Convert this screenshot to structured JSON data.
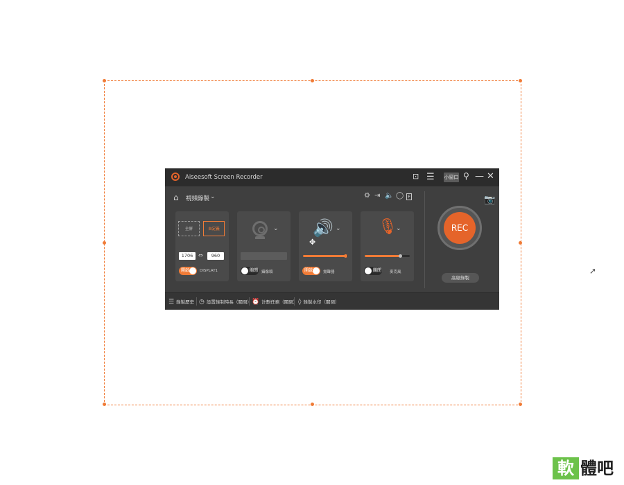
{
  "window": {
    "title": "Aiseesoft Screen Recorder",
    "mini_label": "小窗口",
    "mode_label": "視頻錄製"
  },
  "screen": {
    "fullscreen_label": "全屏",
    "custom_label": "自定義",
    "width": "1706",
    "height": "960",
    "toggle_label": "開啟",
    "display_label": "DISPLAY1"
  },
  "webcam": {
    "toggle_label": "關閉",
    "label": "攝像頭"
  },
  "system_sound": {
    "toggle_label": "開啟",
    "label": "揚聲器",
    "volume": 0.95
  },
  "microphone": {
    "toggle_label": "關閉",
    "label": "麥克風",
    "volume": 0.8
  },
  "rec": {
    "label": "REC",
    "advanced_label": "高級錄製"
  },
  "bottom": {
    "history": "錄製歷史",
    "duration": "設置錄制時長（關閉）",
    "schedule": "計劃任務（關閉）",
    "watermark": "錄製水印（關閉）"
  },
  "watermark_brand": {
    "char1": "軟",
    "rest": "體吧"
  },
  "colors": {
    "accent": "#f07b36",
    "rec": "#e5642a",
    "window_bg": "#3f3f3f",
    "titlebar_bg": "#2c2c2c",
    "brand_green": "#6cc24a"
  },
  "icons": [
    "home-icon",
    "settings-icon",
    "export-icon",
    "speaker-icon",
    "mouse-icon",
    "hotkey-icon",
    "camera-icon",
    "pin-icon",
    "close-icon",
    "minimize-icon",
    "menu-icon",
    "chat-icon"
  ]
}
